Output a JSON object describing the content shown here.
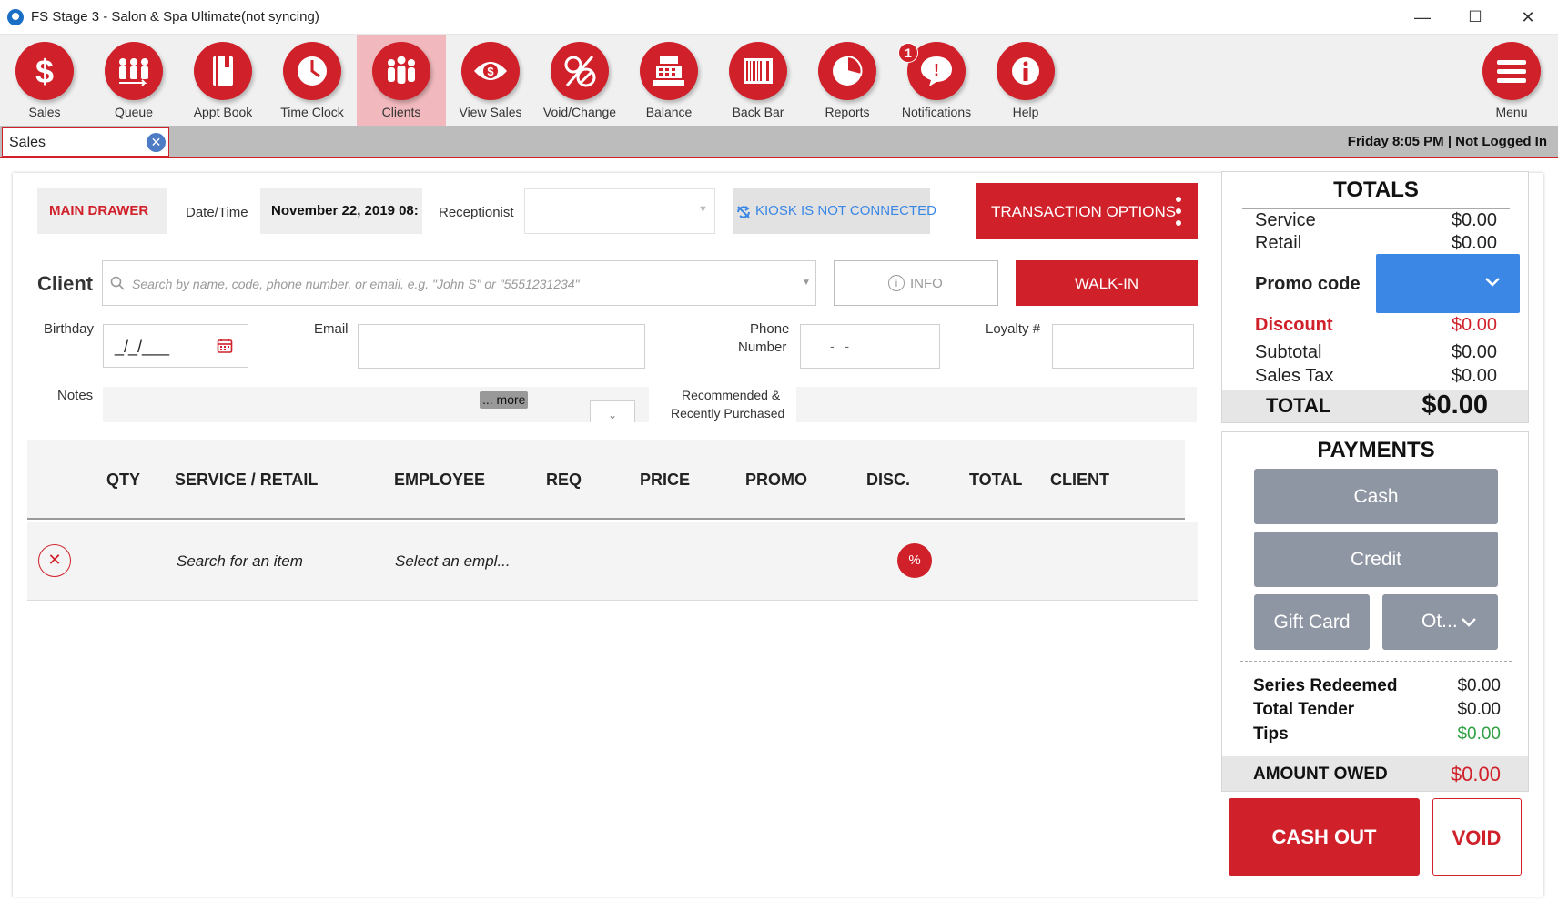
{
  "window": {
    "title": "FS Stage 3 - Salon & Spa Ultimate(not syncing)",
    "minimize": "—",
    "maximize": "☐",
    "close": "✕"
  },
  "toolbar": {
    "items": [
      {
        "label": "Sales",
        "icon": "dollar-icon"
      },
      {
        "label": "Queue",
        "icon": "queue-icon"
      },
      {
        "label": "Appt Book",
        "icon": "appt-book-icon"
      },
      {
        "label": "Time Clock",
        "icon": "clock-icon"
      },
      {
        "label": "Clients",
        "icon": "clients-icon"
      },
      {
        "label": "View Sales",
        "icon": "eye-icon"
      },
      {
        "label": "Void/Change",
        "icon": "void-icon"
      },
      {
        "label": "Balance",
        "icon": "register-icon"
      },
      {
        "label": "Back Bar",
        "icon": "barcode-icon"
      },
      {
        "label": "Reports",
        "icon": "pie-chart-icon"
      },
      {
        "label": "Notifications",
        "icon": "speech-bubble-icon"
      },
      {
        "label": "Help",
        "icon": "info-icon"
      }
    ],
    "active_index": 4,
    "notification_count": "1",
    "menu_label": "Menu"
  },
  "tabs": {
    "active_label": "Sales",
    "close": "✕"
  },
  "status": "Friday 8:05 PM | Not Logged In",
  "header": {
    "drawer": "MAIN DRAWER",
    "datetime_label": "Date/Time",
    "datetime_value": "November 22, 2019 08:",
    "receptionist_label": "Receptionist",
    "kiosk": "KIOSK IS NOT CONNECTED",
    "transaction_options": "TRANSACTION OPTIONS"
  },
  "client": {
    "label": "Client",
    "search_placeholder": "Search by name, code, phone number, or email. e.g. \"John S\" or \"5551231234\"",
    "info_button": "INFO",
    "walkin_button": "WALK-IN",
    "birthday_label": "Birthday",
    "birthday_value": "_/_/___",
    "email_label": "Email",
    "phone_label_1": "Phone",
    "phone_label_2": "Number",
    "phone_value": "-   -",
    "loyalty_label": "Loyalty #",
    "notes_label": "Notes",
    "more_button": "... more",
    "recommended_1": "Recommended &",
    "recommended_2": "Recently Purchased"
  },
  "table": {
    "headers": [
      "QTY",
      "SERVICE / RETAIL",
      "EMPLOYEE",
      "REQ",
      "PRICE",
      "PROMO",
      "DISC.",
      "TOTAL",
      "CLIENT"
    ],
    "row": {
      "item_placeholder": "Search for an item",
      "employee_placeholder": "Select an empl...",
      "discount_symbol": "%"
    }
  },
  "totals": {
    "title": "TOTALS",
    "service_label": "Service",
    "service_value": "$0.00",
    "retail_label": "Retail",
    "retail_value": "$0.00",
    "promo_label": "Promo code",
    "discount_label": "Discount",
    "discount_value": "$0.00",
    "subtotal_label": "Subtotal",
    "subtotal_value": "$0.00",
    "tax_label": "Sales Tax",
    "tax_value": "$0.00",
    "total_label": "TOTAL",
    "total_value": "$0.00"
  },
  "payments": {
    "title": "PAYMENTS",
    "cash": "Cash",
    "credit": "Credit",
    "gift_card": "Gift Card",
    "other": "Ot...",
    "series_label": "Series Redeemed",
    "series_value": "$0.00",
    "tender_label": "Total Tender",
    "tender_value": "$0.00",
    "tips_label": "Tips",
    "tips_value": "$0.00",
    "owed_label": "AMOUNT OWED",
    "owed_value": "$0.00"
  },
  "actions": {
    "cash_out": "CASH OUT",
    "void": "VOID"
  },
  "colors": {
    "brand_red": "#d0202a",
    "promo_blue": "#3a87e6",
    "pay_gray": "#8f96a3",
    "tips_green": "#2ea043"
  }
}
